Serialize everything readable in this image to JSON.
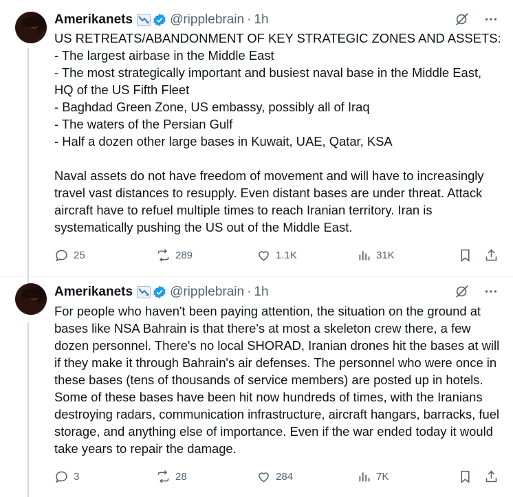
{
  "tweets": [
    {
      "author": {
        "name": "Amerikanets",
        "flag_icon": "chart-down-flag-icon",
        "verified": true,
        "handle": "@ripplebrain"
      },
      "time": "1h",
      "text": "US RETREATS/ABANDONMENT OF KEY STRATEGIC ZONES AND ASSETS:\n- The largest airbase in the Middle East\n- The most strategically important and busiest naval base in the Middle East, HQ of the US Fifth Fleet\n- Baghdad Green Zone, US embassy, possibly all of Iraq\n- The waters of the Persian Gulf\n- Half a dozen other large bases in Kuwait, UAE, Qatar, KSA\n\nNaval assets do not have freedom of movement and will have to increasingly travel vast distances to resupply. Even distant bases are under threat. Attack aircraft have to refuel multiple times to reach Iranian territory. Iran is systematically pushing the US out of the Middle East.",
      "stats": {
        "replies": "25",
        "reposts": "289",
        "likes": "1.1K",
        "views": "31K"
      }
    },
    {
      "author": {
        "name": "Amerikanets",
        "flag_icon": "chart-down-flag-icon",
        "verified": true,
        "handle": "@ripplebrain"
      },
      "time": "1h",
      "text": "For people who haven't been paying attention, the situation on the ground at bases like NSA Bahrain is that there's at most a skeleton crew there, a few dozen personnel. There's no local SHORAD, Iranian drones hit the bases at will if they make it through Bahrain's air defenses. The personnel who were once in these bases (tens of thousands of service members) are posted up in hotels. Some of these bases have been hit now hundreds of times, with the Iranians destroying radars, communication infrastructure, aircraft hangars, barracks, fuel storage, and anything else of importance. Even if the war ended today it would take years to repair the damage.",
      "stats": {
        "replies": "3",
        "reposts": "28",
        "likes": "284",
        "views": "7K"
      }
    }
  ],
  "colors": {
    "text": "#0f1419",
    "muted": "#536471",
    "verified": "#1d9bf0",
    "thread_line": "#cfd9de"
  }
}
